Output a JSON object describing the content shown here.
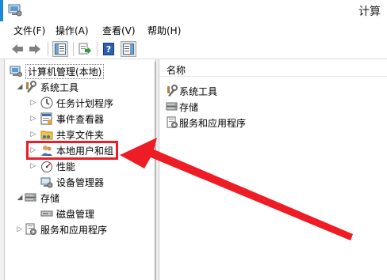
{
  "window": {
    "title": "计算"
  },
  "menubar": {
    "items": [
      {
        "label": "文件(F)"
      },
      {
        "label": "操作(A)"
      },
      {
        "label": "查看(V)"
      },
      {
        "label": "帮助(H)"
      }
    ]
  },
  "toolbar": {
    "buttons": [
      "back-icon",
      "forward-icon",
      "console-tree-icon",
      "export-list-icon",
      "help-icon",
      "action-pane-icon"
    ]
  },
  "tree": {
    "root": {
      "label": "计算机管理(本地)"
    },
    "system_tools": {
      "label": "系统工具"
    },
    "task_scheduler": {
      "label": "任务计划程序"
    },
    "event_viewer": {
      "label": "事件查看器"
    },
    "shared_folders": {
      "label": "共享文件夹"
    },
    "local_users": {
      "label": "本地用户和组"
    },
    "performance": {
      "label": "性能"
    },
    "device_manager": {
      "label": "设备管理器"
    },
    "storage": {
      "label": "存储"
    },
    "disk_management": {
      "label": "磁盘管理"
    },
    "services_apps": {
      "label": "服务和应用程序"
    }
  },
  "right_list": {
    "column_header": "名称",
    "items": [
      {
        "label": "系统工具"
      },
      {
        "label": "存储"
      },
      {
        "label": "服务和应用程序"
      }
    ]
  },
  "annotation": {
    "color": "#ee1c25"
  }
}
